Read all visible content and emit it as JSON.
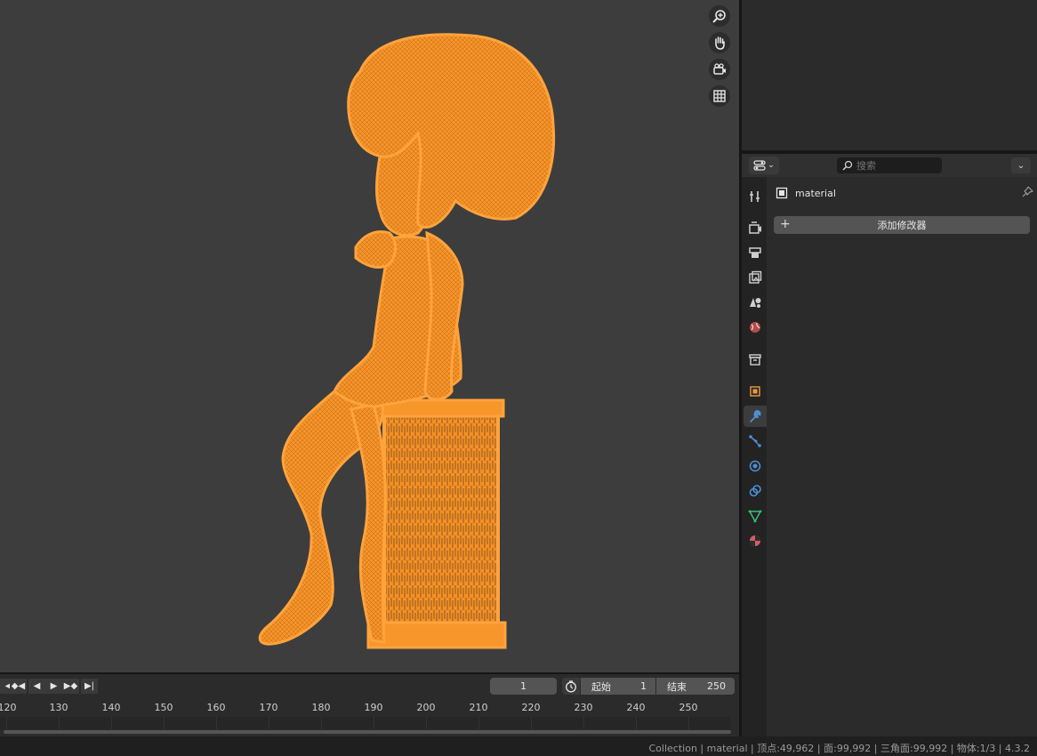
{
  "viewport": {
    "nav_icons": [
      "zoom-icon",
      "pan-hand-icon",
      "camera-view-icon",
      "ortho-grid-icon"
    ],
    "selection_color": "#f7962a"
  },
  "properties": {
    "search_placeholder": "搜索",
    "object_name": "material",
    "add_modifier_label": "添加修改器",
    "tabs": [
      "tool",
      "render",
      "output",
      "view-layer",
      "scene",
      "world",
      "collection",
      "object",
      "modifiers",
      "particles",
      "physics",
      "constraints",
      "data",
      "material"
    ],
    "active_tab": "modifiers"
  },
  "timeline": {
    "current_frame": "1",
    "start_label": "起始",
    "start_value": "1",
    "end_label": "结束",
    "end_value": "250",
    "ticks": [
      "120",
      "130",
      "140",
      "150",
      "160",
      "170",
      "180",
      "190",
      "200",
      "210",
      "220",
      "230",
      "240",
      "250"
    ]
  },
  "statusbar": {
    "text": "Collection | material | 顶点:49,962 | 面:99,992 | 三角面:99,992 | 物体:1/3 | 4.3.2"
  }
}
